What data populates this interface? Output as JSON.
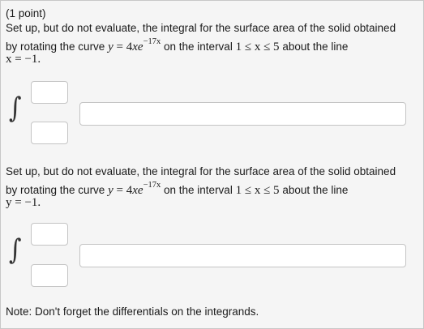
{
  "header": {
    "points": "(1 point)"
  },
  "question1": {
    "line1": "Set up, but do not evaluate, the integral for the surface area of the solid obtained",
    "line2_prefix": "by rotating the curve",
    "curve_lhs": "y",
    "curve_eq": " = 4",
    "curve_x": "x",
    "curve_e": "e",
    "curve_exp": "−17x",
    "line2_mid": "on the interval",
    "interval": "1 ≤ x ≤ 5",
    "line2_suffix": "about the line",
    "axis_line": "x = −1.",
    "upper_limit": "",
    "lower_limit": "",
    "integrand": ""
  },
  "question2": {
    "line1": "Set up, but do not evaluate, the integral for the surface area of the solid obtained",
    "line2_prefix": "by rotating the curve",
    "curve_lhs": "y",
    "curve_eq": " = 4",
    "curve_x": "x",
    "curve_e": "e",
    "curve_exp": "−17x",
    "line2_mid": "on the interval",
    "interval": "1 ≤ x ≤ 5",
    "line2_suffix": "about the line",
    "axis_line": "y = −1.",
    "upper_limit": "",
    "lower_limit": "",
    "integrand": ""
  },
  "note": "Note: Don't forget the differentials on the integrands.",
  "integral_symbol": "∫"
}
